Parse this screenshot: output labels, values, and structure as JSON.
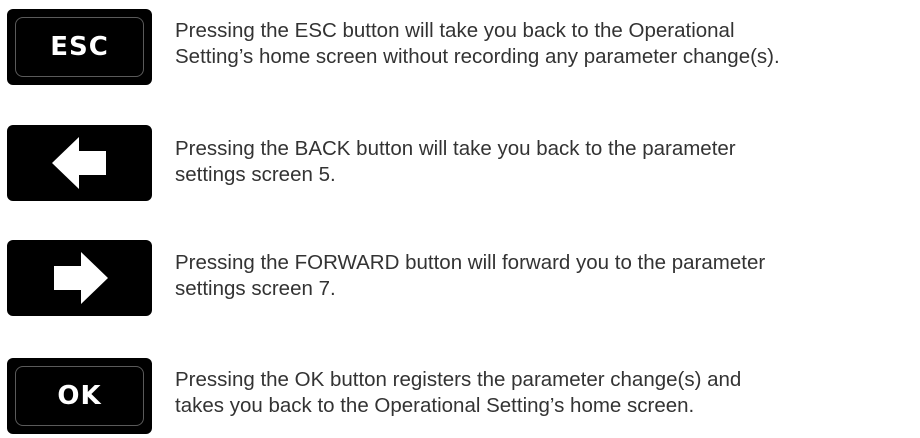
{
  "rows": [
    {
      "button_label": "ESC",
      "icon": "esc-button",
      "line1": "Pressing the ESC button will take you back to the Operational",
      "line2": "Setting’s home screen without recording any parameter change(s)."
    },
    {
      "icon": "arrow-left-icon",
      "line1": "Pressing the BACK button will take you back to the parameter",
      "line2": "settings screen 5."
    },
    {
      "icon": "arrow-right-icon",
      "line1": "Pressing the FORWARD button will forward you to the parameter",
      "line2": "settings screen 7."
    },
    {
      "button_label": "OK",
      "icon": "ok-button",
      "line1": "Pressing the OK button registers the parameter change(s) and",
      "line2": "takes you back to the Operational Setting’s home screen."
    }
  ],
  "colors": {
    "button_bg": "#000000",
    "button_fg": "#ffffff",
    "bezel": "#5a5a5a",
    "text": "#333333"
  }
}
